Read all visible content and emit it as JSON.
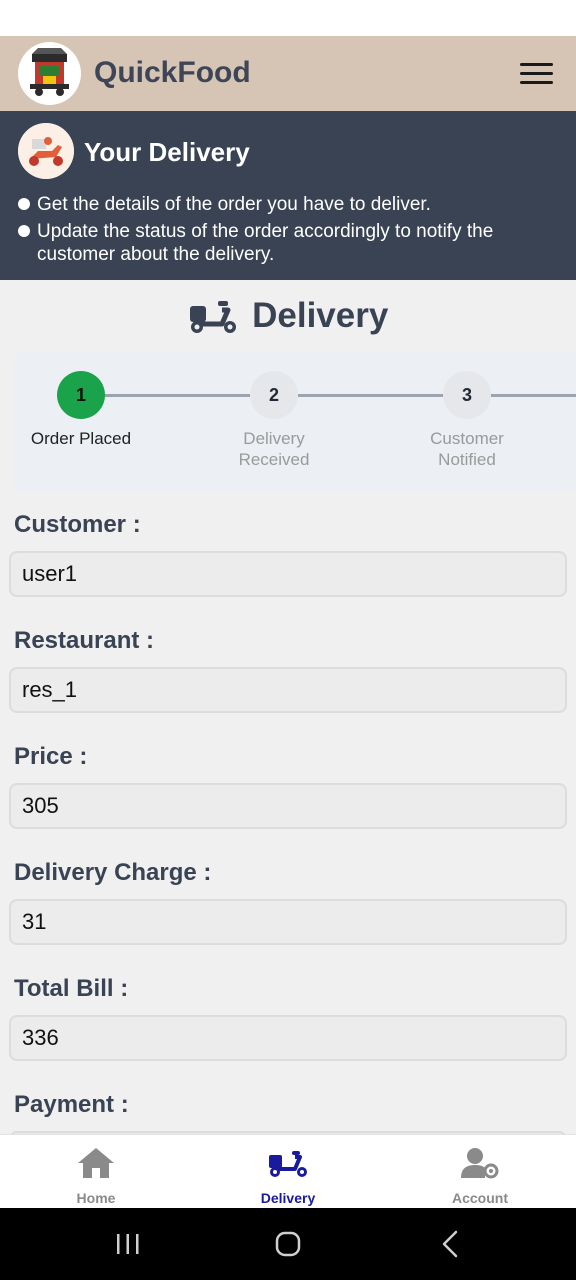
{
  "app": {
    "title": "QuickFood",
    "logo_icon": "food-truck-logo-icon",
    "menu_icon": "hamburger-menu-icon"
  },
  "banner": {
    "title": "Your Delivery",
    "avatar_icon": "delivery-scooter-illustration-icon",
    "points": [
      "Get the details of the order you have to deliver.",
      "Update the status of the order accordingly to notify the customer about the delivery."
    ]
  },
  "section": {
    "title": "Delivery",
    "icon": "delivery-scooter-icon"
  },
  "stepper": {
    "current_step": 1,
    "steps": [
      {
        "number": "1",
        "label": "Order Placed"
      },
      {
        "number": "2",
        "label": "Delivery Received"
      },
      {
        "number": "3",
        "label": "Customer Notified"
      }
    ]
  },
  "fields": [
    {
      "label": "Customer :",
      "value": "user1"
    },
    {
      "label": "Restaurant :",
      "value": "res_1"
    },
    {
      "label": "Price :",
      "value": "305"
    },
    {
      "label": "Delivery Charge :",
      "value": "31"
    },
    {
      "label": "Total Bill :",
      "value": "336"
    },
    {
      "label": "Payment :",
      "value": ""
    }
  ],
  "bottom_nav": {
    "active": "Delivery",
    "items": [
      {
        "label": "Home",
        "icon": "home-icon"
      },
      {
        "label": "Delivery",
        "icon": "delivery-scooter-icon"
      },
      {
        "label": "Account",
        "icon": "user-settings-icon"
      }
    ]
  },
  "colors": {
    "appbar": "#d6c5b5",
    "banner": "#3a4354",
    "step_active": "#1aa34a",
    "nav_active": "#1a1a9e"
  }
}
